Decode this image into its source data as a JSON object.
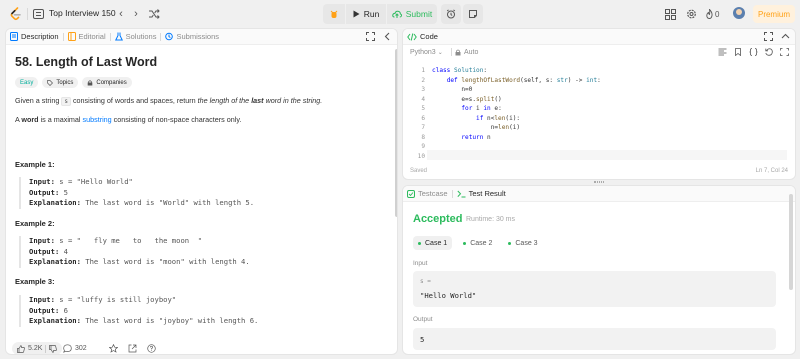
{
  "topnav": {
    "problem_list_title": "Top Interview 150",
    "prev_icon": "chevron-left-icon",
    "next_icon": "chevron-right-icon",
    "run_label": "Run",
    "submit_label": "Submit",
    "fire_count": "0",
    "premium_label": "Premium",
    "colors": {
      "submit": "#2cbb5d",
      "premium": "#ffa116",
      "premium_bg": "#fff1dd"
    }
  },
  "left": {
    "tabs": [
      "Description",
      "Editorial",
      "Solutions",
      "Submissions"
    ],
    "problem_title": "58. Length of Last Word",
    "tags": {
      "difficulty": "Easy",
      "topics": "Topics",
      "companies": "Companies"
    },
    "para1": {
      "t1": "Given a string ",
      "code": "s",
      "t2": " consisting of words and spaces, return ",
      "em1": "the length of the ",
      "strong": "last",
      "em2": " word in the string."
    },
    "para2": {
      "t1": "A ",
      "strong": "word",
      "t2": " is a maximal ",
      "link": "substring",
      "t3": " consisting of non-space characters only."
    },
    "examples": [
      {
        "title": "Example 1:",
        "input_label": "Input:",
        "input": " s = \"Hello World\"",
        "output_label": "Output:",
        "output": " 5",
        "explanation_label": "Explanation:",
        "explanation": " The last word is \"World\" with length 5."
      },
      {
        "title": "Example 2:",
        "input_label": "Input:",
        "input": " s = \"   fly me   to   the moon  \"",
        "output_label": "Output:",
        "output": " 4",
        "explanation_label": "Explanation:",
        "explanation": " The last word is \"moon\" with length 4."
      },
      {
        "title": "Example 3:",
        "input_label": "Input:",
        "input": " s = \"luffy is still joyboy\"",
        "output_label": "Output:",
        "output": " 6",
        "explanation_label": "Explanation:",
        "explanation": " The last word is \"joyboy\" with length 6."
      }
    ],
    "bottom": {
      "likes": "5.2K",
      "comments": "302"
    }
  },
  "code": {
    "tab_label": "Code",
    "language": "Python3",
    "auto_label": "Auto",
    "line_numbers": [
      "1",
      "2",
      "3",
      "4",
      "5",
      "6",
      "7",
      "8",
      "9",
      "10"
    ],
    "saved_label": "Saved",
    "cursor_position": "Ln 7, Col 24"
  },
  "result": {
    "tabs": [
      "Testcase",
      "Test Result"
    ],
    "status": "Accepted",
    "runtime": "Runtime: 30 ms",
    "cases": [
      "Case 1",
      "Case 2",
      "Case 3"
    ],
    "input_label": "Input",
    "input_var": "s =",
    "input_value": "\"Hello World\"",
    "output_label": "Output",
    "output_value": "5"
  }
}
